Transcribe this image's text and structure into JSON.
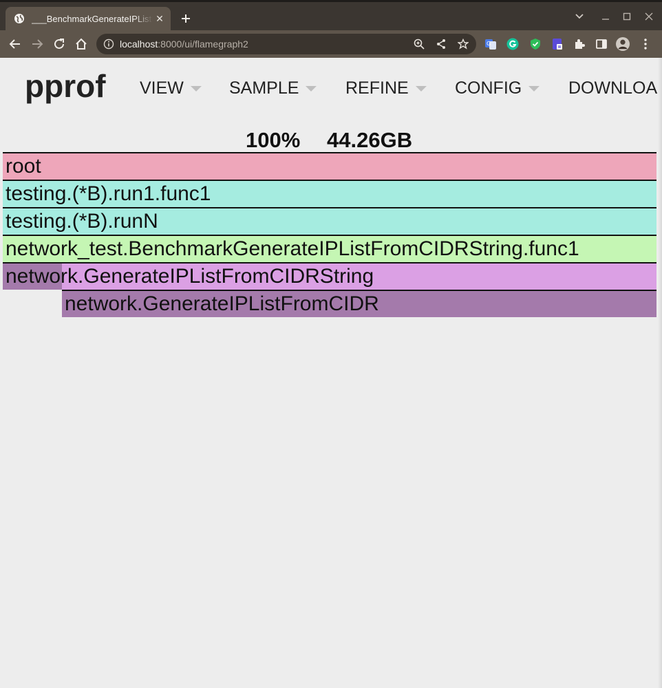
{
  "browser": {
    "tab_title": "___BenchmarkGenerateIPListFromCIDRString",
    "url_host": "localhost",
    "url_rest": ":8000/ui/flamegraph2"
  },
  "app": {
    "logo": "pprof",
    "menu": [
      {
        "label": "VIEW"
      },
      {
        "label": "SAMPLE"
      },
      {
        "label": "REFINE"
      },
      {
        "label": "CONFIG"
      },
      {
        "label": "DOWNLOAD"
      }
    ]
  },
  "summary": {
    "percent": "100%",
    "total": "44.26GB"
  },
  "flamegraph": {
    "frames": [
      {
        "name": "root",
        "depth": 0,
        "color": "#eea6ba"
      },
      {
        "name": "testing.(*B).run1.func1",
        "depth": 1,
        "color": "#a5ece0"
      },
      {
        "name": "testing.(*B).runN",
        "depth": 2,
        "color": "#a5ece0"
      },
      {
        "name": "network_test.BenchmarkGenerateIPListFromCIDRString.func1",
        "depth": 3,
        "color": "#c5f6b4"
      },
      {
        "name": "network.GenerateIPListFromCIDRString",
        "depth": 4,
        "color": "#dba0e4",
        "self_color": "#a47aab"
      },
      {
        "name": "network.GenerateIPListFromCIDR",
        "depth": 5,
        "color": "#a47aab"
      }
    ]
  }
}
